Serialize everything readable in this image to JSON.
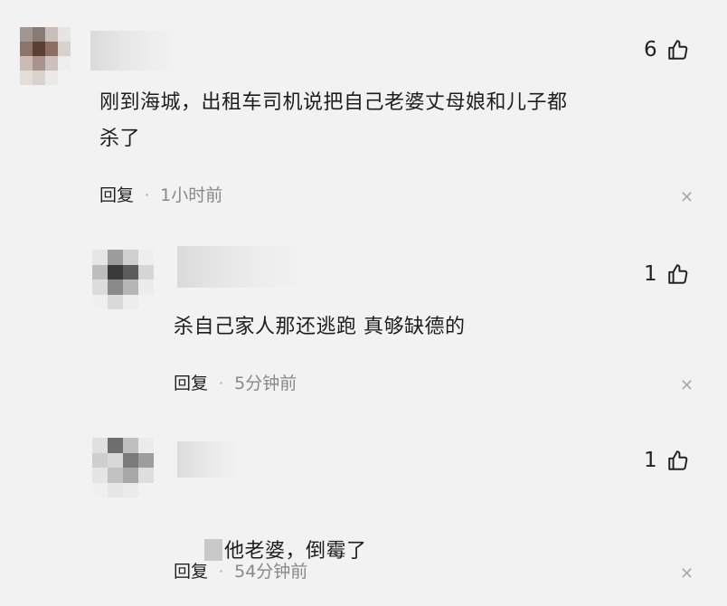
{
  "comments": [
    {
      "text": "刚到海城，出租车司机说把自己老婆丈母娘和儿子都\n杀了",
      "likes": "6",
      "reply_label": "回复",
      "separator": "·",
      "time": "1小时前",
      "close_icon": "close-icon"
    },
    {
      "text": "杀自己家人那还逃跑 真够缺德的",
      "likes": "1",
      "reply_label": "回复",
      "separator": "·",
      "time": "5分钟前",
      "close_icon": "close-icon"
    },
    {
      "text": "他老婆，倒霉了",
      "likes": "1",
      "reply_label": "回复",
      "separator": "·",
      "time": "54分钟前",
      "close_icon": "close-icon"
    }
  ],
  "icons": {
    "like": "thumbs-up-icon",
    "close": "close-icon"
  },
  "colors": {
    "background": "#f2f2f2",
    "text": "#1d1d1d",
    "meta": "#888888"
  }
}
